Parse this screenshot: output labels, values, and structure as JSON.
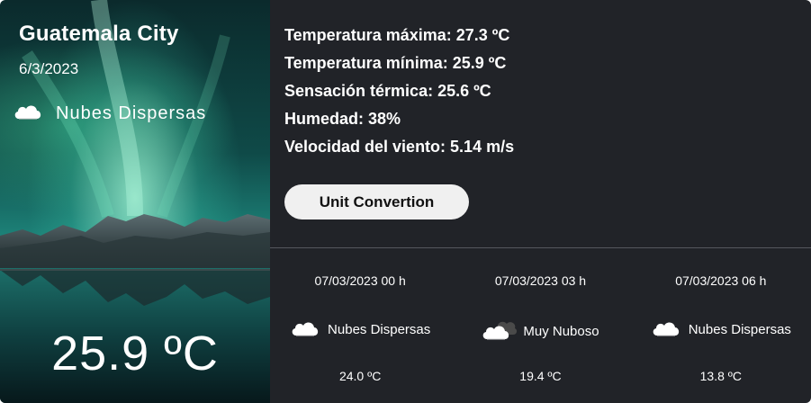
{
  "location": {
    "city": "Guatemala City",
    "date": "6/3/2023",
    "condition": "Nubes Dispersas",
    "condition_icon": "cloud-icon",
    "temperature": "25.9 ºC"
  },
  "details": [
    "Temperatura máxima: 27.3 ºC",
    "Temperatura mínima: 25.9 ºC",
    "Sensación térmica: 25.6 ºC",
    "Humedad: 38%",
    "Velocidad del viento: 5.14 m/s"
  ],
  "unit_button_label": "Unit Convertion",
  "forecast": [
    {
      "time": "07/03/2023 00 h",
      "condition": "Nubes Dispersas",
      "icon": "cloud-icon",
      "temp": "24.0 ºC"
    },
    {
      "time": "07/03/2023 03 h",
      "condition": "Muy Nuboso",
      "icon": "dark-clouds-icon",
      "temp": "19.4 ºC"
    },
    {
      "time": "07/03/2023 06 h",
      "condition": "Nubes Dispersas",
      "icon": "cloud-icon",
      "temp": "13.8 ºC"
    }
  ],
  "colors": {
    "panel_bg": "#212328",
    "button_bg": "#f0f0f0",
    "text": "#ffffff"
  }
}
